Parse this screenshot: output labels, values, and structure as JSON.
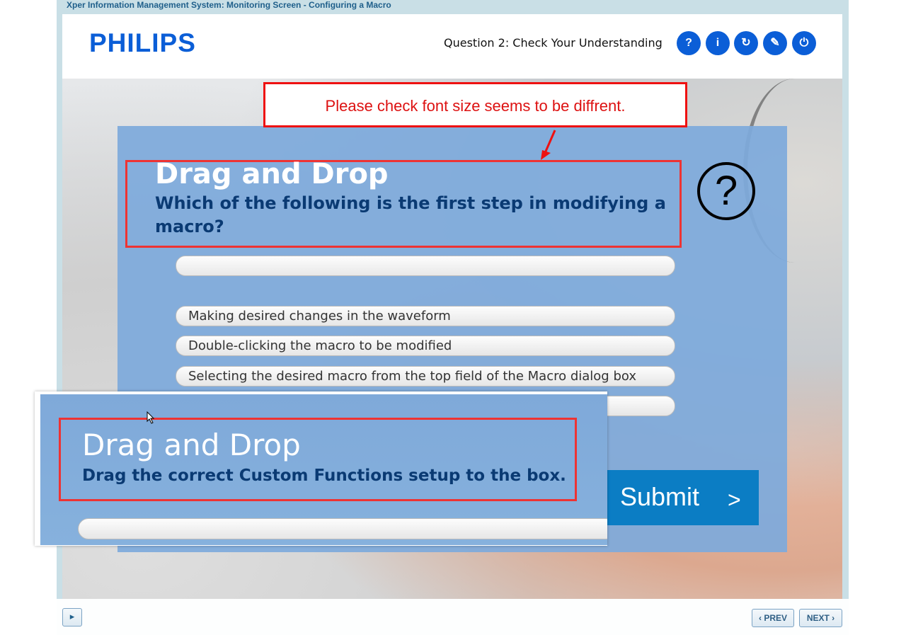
{
  "window": {
    "title": "Xper Information Management System: Monitoring Screen - Configuring a Macro"
  },
  "header": {
    "logo": "PHILIPS",
    "question_title": "Question 2: Check Your Understanding",
    "buttons": [
      {
        "label": "?",
        "icon": "help-icon"
      },
      {
        "label": "i",
        "icon": "info-icon"
      },
      {
        "label": "↻",
        "icon": "refresh-icon"
      },
      {
        "label": "✎",
        "icon": "compass-icon"
      },
      {
        "label": "⏻",
        "icon": "power-icon"
      }
    ]
  },
  "annotation": {
    "text": "Please check font size seems to be diffrent."
  },
  "question": {
    "heading": "Drag and Drop",
    "prompt": "Which of the following is the first step in modifying a macro?",
    "qmark": "?",
    "options": [
      "Making desired changes in the waveform",
      "Double-clicking the macro to be modified",
      "Selecting the desired macro from the top field of the Macro dialog box",
      ""
    ],
    "submit_label": "Submit",
    "submit_arrow": ">"
  },
  "overlay": {
    "heading": "Drag and Drop",
    "prompt": "Drag the correct Custom Functions setup to the box."
  },
  "footer": {
    "audio_icon": "speaker-icon",
    "prev_label": "‹ PREV",
    "next_label": "NEXT ›"
  },
  "colors": {
    "accent": "#0b5ed7",
    "panel": "#7eaadb",
    "annotation": "#e11111",
    "submit": "#0b7dc4"
  }
}
